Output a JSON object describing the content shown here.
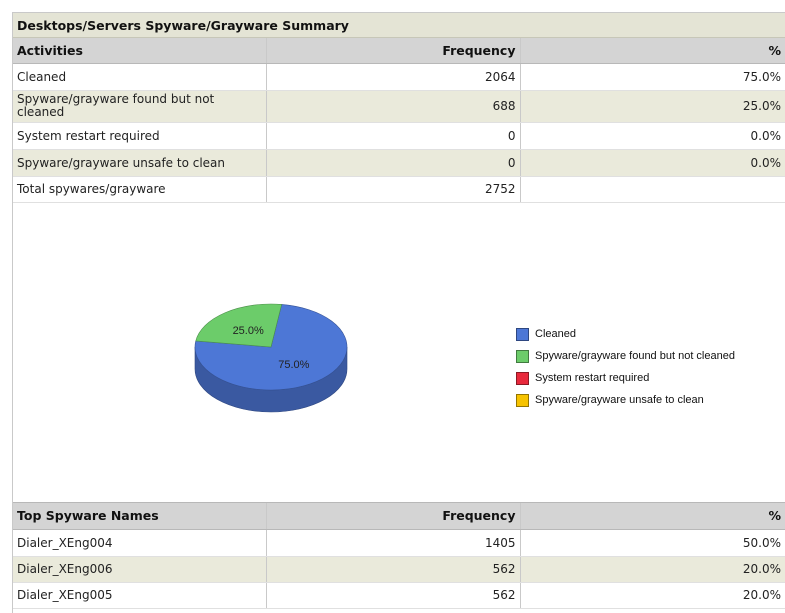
{
  "summary": {
    "title": "Desktops/Servers Spyware/Grayware Summary",
    "columns": [
      "Activities",
      "Frequency",
      "%"
    ],
    "rows": [
      {
        "activity": "Cleaned",
        "frequency": "2064",
        "percent": "75.0%"
      },
      {
        "activity": "Spyware/grayware found but not cleaned",
        "frequency": "688",
        "percent": "25.0%"
      },
      {
        "activity": "System restart required",
        "frequency": "0",
        "percent": "0.0%"
      },
      {
        "activity": "Spyware/grayware unsafe to clean",
        "frequency": "0",
        "percent": "0.0%"
      },
      {
        "activity": "Total spywares/grayware",
        "frequency": "2752",
        "percent": ""
      }
    ]
  },
  "chart_data": {
    "type": "pie",
    "categories": [
      "Cleaned",
      "Spyware/grayware found but not cleaned",
      "System restart required",
      "Spyware/grayware unsafe to clean"
    ],
    "values": [
      2064,
      688,
      0,
      0
    ],
    "slice_labels": [
      "75.0%",
      "25.0%",
      "",
      ""
    ],
    "colors": [
      "#4d77d6",
      "#6ccc6a",
      "#e8293c",
      "#f7c300"
    ],
    "legend_position": "right",
    "style": "3d"
  },
  "top_names": {
    "columns": [
      "Top Spyware Names",
      "Frequency",
      "%"
    ],
    "rows": [
      {
        "name": "Dialer_XEng004",
        "frequency": "1405",
        "percent": "50.0%"
      },
      {
        "name": "Dialer_XEng006",
        "frequency": "562",
        "percent": "20.0%"
      },
      {
        "name": "Dialer_XEng005",
        "frequency": "562",
        "percent": "20.0%"
      }
    ]
  }
}
